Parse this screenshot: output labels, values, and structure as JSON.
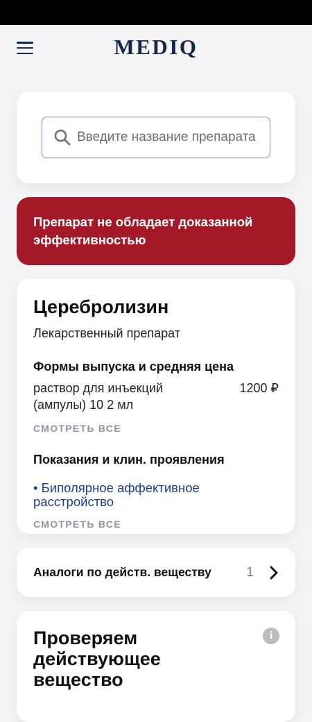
{
  "app": {
    "logo": "MEDIQ"
  },
  "search": {
    "placeholder": "Введите название препарата"
  },
  "warning": {
    "text": "Препарат не обладает доказанной эффективностью"
  },
  "drug": {
    "name": "Церебролизин",
    "type": "Лекарственный препарат",
    "forms": {
      "title": "Формы выпуска и средняя цена",
      "items": [
        {
          "name": "раствор для инъекций (ампулы) 10 2 мл",
          "price": "1200 ₽"
        }
      ],
      "see_all": "СМОТРЕТЬ ВСЕ"
    },
    "indications": {
      "title": "Показания и клин. проявления",
      "items": [
        "• Биполярное аффективное расстройство"
      ],
      "see_all": "СМОТРЕТЬ ВСЕ"
    }
  },
  "analogs": {
    "label": "Аналоги по действ. веществу",
    "count": "1"
  },
  "check": {
    "title": "Проверяем действующее вещество"
  },
  "colors": {
    "brand": "#14284b",
    "warning": "#a31928",
    "link": "#1c3f8a"
  },
  "icons": {
    "menu": "hamburger-menu-icon",
    "search": "search-icon",
    "chevron": "chevron-right-icon",
    "info": "info-icon"
  }
}
